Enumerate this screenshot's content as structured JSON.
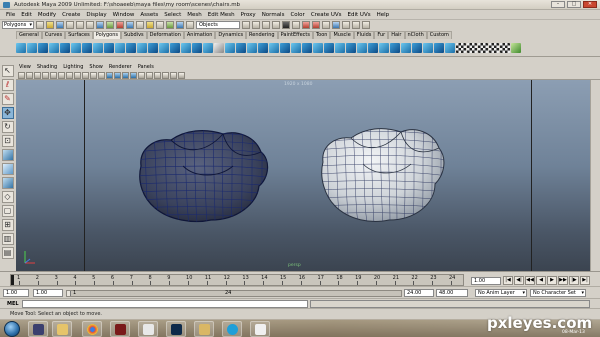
{
  "window": {
    "title": "Autodesk Maya 2009 Unlimited: F:\\shoaeeb\\maya files\\my room\\scenes\\chairs.mb",
    "minimize": "–",
    "maximize": "□",
    "close": "✕"
  },
  "menubar": [
    "File",
    "Edit",
    "Modify",
    "Create",
    "Display",
    "Window",
    "Assets",
    "Select",
    "Mesh",
    "Edit Mesh",
    "Proxy",
    "Normals",
    "Color",
    "Create UVs",
    "Edit UVs",
    "Help"
  ],
  "statusline": {
    "menuset": "Polygons",
    "objects_field": "Objects"
  },
  "shelf_tabs": [
    "General",
    "Curves",
    "Surfaces",
    "Polygons",
    "Subdivs",
    "Deformation",
    "Animation",
    "Dynamics",
    "Rendering",
    "PaintEffects",
    "Toon",
    "Muscle",
    "Fluids",
    "Fur",
    "Hair",
    "nCloth",
    "Custom"
  ],
  "shelf_active_tab": "Polygons",
  "panel_menu": [
    "View",
    "Shading",
    "Lighting",
    "Show",
    "Renderer",
    "Panels"
  ],
  "viewport": {
    "resolution_gate": "1920 x 1080",
    "camera_label": "persp",
    "axis_labels": [
      "x",
      "y",
      "z"
    ]
  },
  "timeline": {
    "ticks": [
      1,
      2,
      3,
      4,
      5,
      6,
      7,
      8,
      9,
      10,
      11,
      12,
      13,
      14,
      15,
      16,
      17,
      18,
      19,
      20,
      21,
      22,
      23,
      24
    ],
    "current_frame": "1.00",
    "playback_buttons": [
      "|◀",
      "◀|",
      "◀◀",
      "◀",
      "▶",
      "▶▶",
      "|▶",
      "▶|"
    ]
  },
  "range": {
    "start_time": "1.00",
    "playback_start": "1.00",
    "range_start": "1",
    "range_end": "24",
    "playback_end": "24.00",
    "end_time": "48.00",
    "anim_layer": "No Anim Layer",
    "character_set": "No Character Set"
  },
  "command_line": {
    "label": "MEL"
  },
  "help_line": {
    "text": "Move Tool: Select an object to move."
  },
  "taskbar": {
    "date": "08-Mar-13"
  },
  "watermark": "pxleyes.com",
  "colors": {
    "viewport_top": "#8c9eb3",
    "viewport_bottom": "#3b4450",
    "mesh_wire": "#1b2a6e",
    "shelf_blue": "#1c6fa8"
  }
}
